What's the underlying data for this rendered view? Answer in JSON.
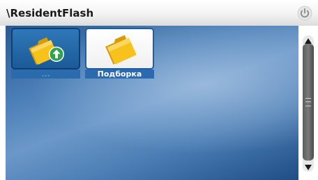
{
  "window": {
    "title": "\\ResidentFlash",
    "power_icon": "power-icon"
  },
  "tiles": [
    {
      "label": "...",
      "icon": "folder-up-icon",
      "selected": false
    },
    {
      "label": "Подборка",
      "icon": "folder-icon",
      "selected": true
    }
  ],
  "scrollbar": {
    "up_icon": "scroll-up-arrow-icon",
    "down_icon": "scroll-down-arrow-icon",
    "thumb_icon": "grip-icon"
  },
  "colors": {
    "accent": "#1e5fa0",
    "folder": "#f5c21a",
    "up_badge": "#2fa24a"
  }
}
